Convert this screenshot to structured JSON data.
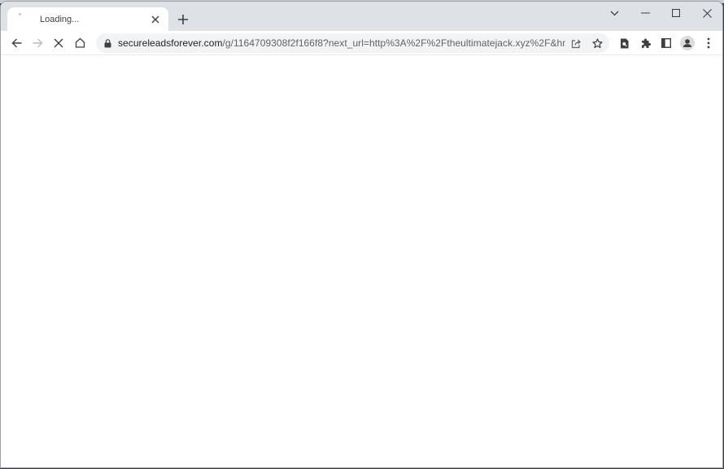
{
  "tab": {
    "title": "Loading...",
    "close_icon": "close-icon",
    "favicon_icon": "loading-spinner-icon"
  },
  "tabstrip": {
    "new_tab_icon": "plus-icon",
    "tab_search_icon": "chevron-down-icon"
  },
  "window_controls": {
    "minimize_icon": "minimize-icon",
    "maximize_icon": "maximize-icon",
    "close_icon": "close-icon"
  },
  "toolbar": {
    "back_icon": "arrow-left-icon",
    "forward_icon": "arrow-right-icon",
    "stop_icon": "stop-loading-icon",
    "home_icon": "home-icon"
  },
  "omnibox": {
    "lock_icon": "lock-icon",
    "url_domain": "secureleadsforever.com",
    "url_path": "/g/1164709308f2f166f8?next_url=http%3A%2F%2Ftheultimatejack.xyz%2F&hmac...",
    "share_icon": "share-icon",
    "bookmark_icon": "star-icon"
  },
  "extensions": {
    "lens_icon": "search-page-icon",
    "extensions_icon": "puzzle-icon",
    "side_panel_icon": "side-panel-icon",
    "profile_icon": "avatar-icon",
    "menu_icon": "kebab-menu-icon"
  },
  "content": {}
}
